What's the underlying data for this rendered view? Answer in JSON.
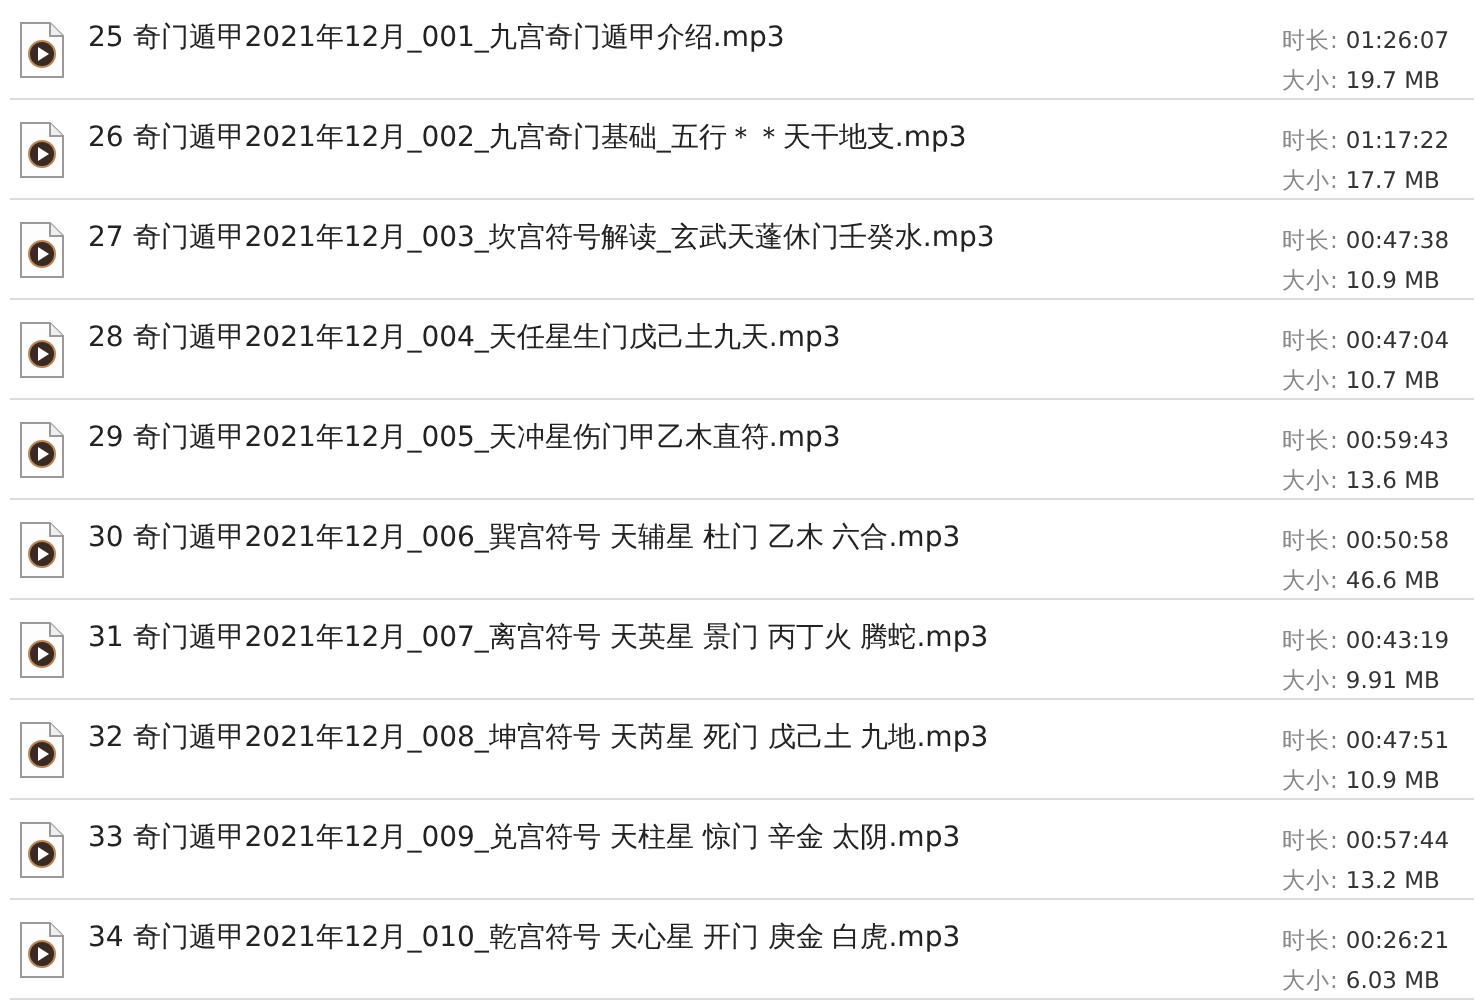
{
  "files": [
    {
      "name": "25 奇门遁甲2021年12月_001_九宫奇门遁甲介绍.mp3",
      "duration_label": "时长:",
      "duration": "01:26:07",
      "size_label": "大小:",
      "size": "19.7 MB"
    },
    {
      "name": "26 奇门遁甲2021年12月_002_九宫奇门基础_五行＊＊天干地支.mp3",
      "duration_label": "时长:",
      "duration": "01:17:22",
      "size_label": "大小:",
      "size": "17.7 MB"
    },
    {
      "name": "27 奇门遁甲2021年12月_003_坎宫符号解读_玄武天蓬休门壬癸水.mp3",
      "duration_label": "时长:",
      "duration": "00:47:38",
      "size_label": "大小:",
      "size": "10.9 MB"
    },
    {
      "name": "28 奇门遁甲2021年12月_004_天任星生门戊己土九天.mp3",
      "duration_label": "时长:",
      "duration": "00:47:04",
      "size_label": "大小:",
      "size": "10.7 MB"
    },
    {
      "name": "29 奇门遁甲2021年12月_005_天冲星伤门甲乙木直符.mp3",
      "duration_label": "时长:",
      "duration": "00:59:43",
      "size_label": "大小:",
      "size": "13.6 MB"
    },
    {
      "name": "30 奇门遁甲2021年12月_006_巽宫符号 天辅星 杜门 乙木 六合.mp3",
      "duration_label": "时长:",
      "duration": "00:50:58",
      "size_label": "大小:",
      "size": "46.6 MB"
    },
    {
      "name": "31 奇门遁甲2021年12月_007_离宫符号 天英星 景门 丙丁火 腾蛇.mp3",
      "duration_label": "时长:",
      "duration": "00:43:19",
      "size_label": "大小:",
      "size": "9.91 MB"
    },
    {
      "name": "32 奇门遁甲2021年12月_008_坤宫符号 天芮星 死门 戊己土 九地.mp3",
      "duration_label": "时长:",
      "duration": "00:47:51",
      "size_label": "大小:",
      "size": "10.9 MB"
    },
    {
      "name": "33 奇门遁甲2021年12月_009_兑宫符号 天柱星 惊门 辛金 太阴.mp3",
      "duration_label": "时长:",
      "duration": "00:57:44",
      "size_label": "大小:",
      "size": "13.2 MB"
    },
    {
      "name": "34 奇门遁甲2021年12月_010_乾宫符号 天心星 开门 庚金 白虎.mp3",
      "duration_label": "时长:",
      "duration": "00:26:21",
      "size_label": "大小:",
      "size": "6.03 MB"
    }
  ]
}
